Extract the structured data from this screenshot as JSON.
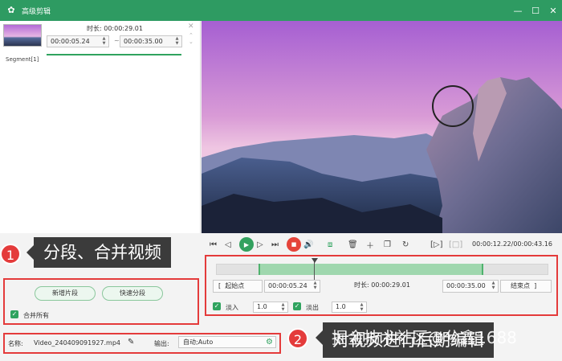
{
  "window": {
    "title": "高级剪辑",
    "minimize": "—",
    "maximize": "☐",
    "close": "✕"
  },
  "segment": {
    "label": "Segment[1]",
    "duration_label": "时长:",
    "duration_value": "00:00:29.01",
    "start": "00:00:05.24",
    "end": "00:00:35.00",
    "separator": "~"
  },
  "player": {
    "time_current": "00:00:12.22",
    "time_total": "00:00:43.16",
    "time_sep": "/"
  },
  "trim": {
    "start_label": "起始点",
    "start_value": "00:00:05.24",
    "duration_label": "时长:",
    "duration_value": "00:00:29.01",
    "end_value": "00:00:35.00",
    "end_label": "结束点",
    "fade_in_label": "淡入",
    "fade_in_value": "1.0",
    "fade_out_label": "淡出",
    "fade_out_value": "1.0",
    "progress": 0.28
  },
  "left_actions": {
    "new_segment": "新增片段",
    "quick_split": "快速分段",
    "merge_all": "合并所有"
  },
  "output": {
    "name_label": "名称:",
    "name_value": "Video_240409091927.mp4",
    "output_label": "输出:",
    "output_value": "自动;Auto"
  },
  "annotations": {
    "badge1": "1",
    "callout1": "分段、合并视频",
    "badge2": "2",
    "callout2": "对视频进行后期编辑",
    "watermark": "掘金技术社区@兮鑫1688"
  },
  "colors": {
    "accent": "#2e9b62",
    "annotation": "#e43b3b"
  }
}
